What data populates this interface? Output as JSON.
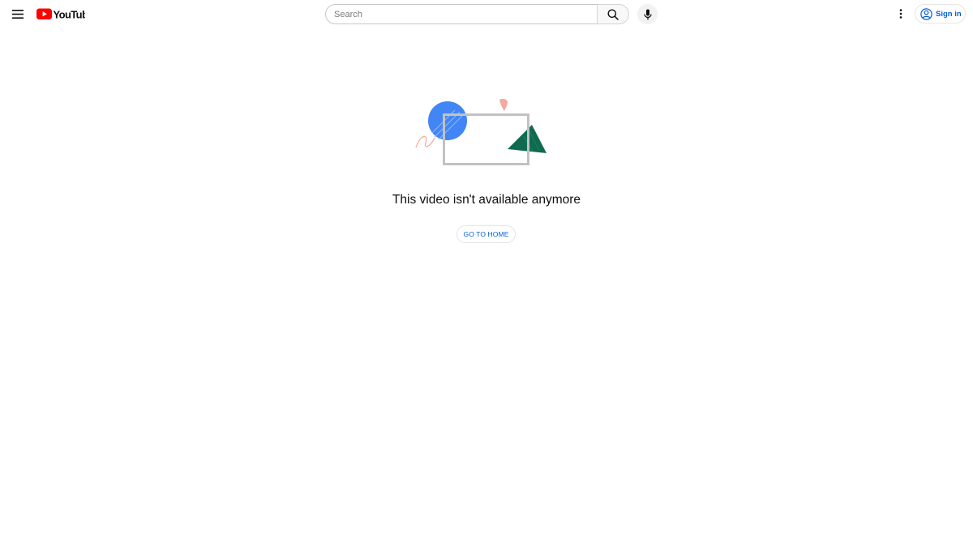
{
  "header": {
    "search": {
      "placeholder": "Search",
      "value": ""
    },
    "sign_in_label": "Sign in",
    "logo_text": "YouTube"
  },
  "main": {
    "message": "This video isn't available anymore",
    "home_button_label": "GO TO HOME"
  },
  "icons": {
    "menu": "hamburger-menu-icon",
    "search": "search-icon",
    "mic": "microphone-icon",
    "more": "more-vertical-icon",
    "account": "account-circle-icon"
  },
  "colors": {
    "brand_red": "#ff0000",
    "link_blue": "#065fd4",
    "illustration_blue": "#4285f4",
    "illustration_green": "#0f6b50",
    "illustration_pink": "#f5a9a0"
  }
}
